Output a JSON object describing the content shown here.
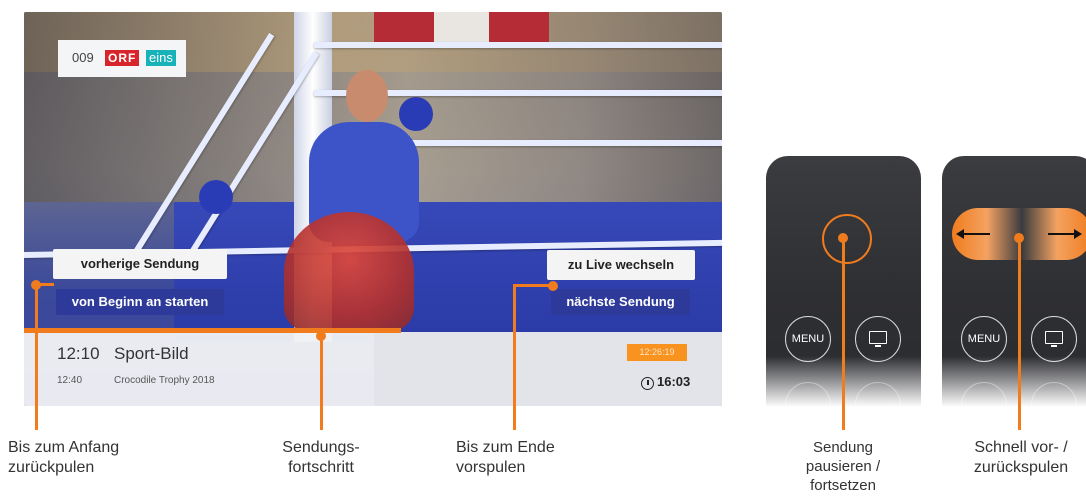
{
  "player": {
    "channel": {
      "number": "009",
      "logo_orf": "ORF",
      "logo_eins": "eins"
    },
    "buttons": {
      "previous_show": "vorherige Sendung",
      "start_from_beginning": "von Beginn an starten",
      "switch_to_live": "zu Live wechseln",
      "next_show": "nächste Sendung"
    },
    "infobar": {
      "current_start": "12:10",
      "current_title": "Sport-Bild",
      "next_start": "12:40",
      "next_title": "Crocodile Trophy 2018",
      "playback_position": "12:26:19",
      "current_time": "16:03",
      "progress_fraction": 0.54
    }
  },
  "captions": {
    "rewind_to_start": [
      "Bis zum Anfang",
      "zurückpulen"
    ],
    "show_progress": [
      "Sendungs-",
      "fortschritt"
    ],
    "forward_to_end": [
      "Bis zum Ende",
      "vorspulen"
    ],
    "pause_resume": [
      "Sendung",
      "pausieren /",
      "fortsetzen"
    ],
    "fast_forward_rewind": [
      "Schnell vor- /",
      "zurückspulen"
    ]
  },
  "remote": {
    "menu_label": "MENU"
  },
  "colors": {
    "accent": "#f07c1e",
    "button_dark": "#2d3a9a",
    "orf_red": "#d8252c",
    "eins_teal": "#18b3b8"
  },
  "icons": [
    "clock-icon",
    "tv-icon",
    "arrow-left-icon",
    "arrow-right-icon"
  ]
}
